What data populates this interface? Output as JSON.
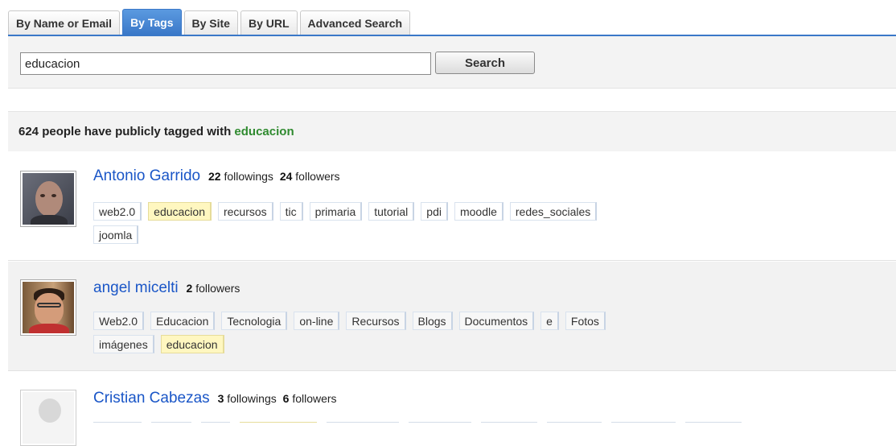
{
  "tabs": [
    {
      "label": "By Name or Email",
      "active": false
    },
    {
      "label": "By Tags",
      "active": true
    },
    {
      "label": "By Site",
      "active": false
    },
    {
      "label": "By URL",
      "active": false
    },
    {
      "label": "Advanced Search",
      "active": false
    }
  ],
  "search": {
    "value": "educacion",
    "button_label": "Search"
  },
  "results": {
    "count": "624",
    "summary_text": "people have publicly tagged with",
    "term": "educacion"
  },
  "people": [
    {
      "name": "Antonio Garrido",
      "followings_count": "22",
      "followings_label": "followings",
      "followers_count": "24",
      "followers_label": "followers",
      "tags": [
        "web2.0",
        "educacion",
        "recursos",
        "tic",
        "primaria",
        "tutorial",
        "pdi",
        "moodle",
        "redes_sociales",
        "joomla"
      ],
      "highlighted_tags": [
        "educacion"
      ]
    },
    {
      "name": "angel micelti",
      "followers_count": "2",
      "followers_label": "followers",
      "tags": [
        "Web2.0",
        "Educacion",
        "Tecnologia",
        "on-line",
        "Recursos",
        "Blogs",
        "Documentos",
        "e",
        "Fotos",
        "imágenes",
        "educacion"
      ],
      "highlighted_tags": [
        "educacion"
      ]
    },
    {
      "name": "Cristian Cabezas",
      "followings_count": "3",
      "followings_label": "followings",
      "followers_count": "6",
      "followers_label": "followers",
      "tags": []
    }
  ],
  "colors": {
    "accent": "#3a78c8",
    "link": "#1a56c7",
    "term": "#2f8a2f",
    "highlight": "#fff7c0"
  },
  "icons": {
    "avatar_placeholder": "person-silhouette-icon"
  }
}
